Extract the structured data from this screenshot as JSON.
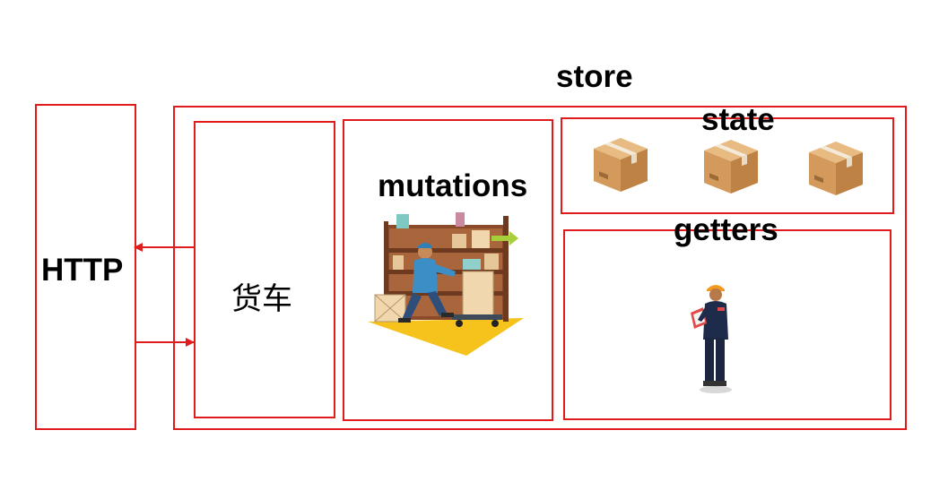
{
  "diagram": {
    "http_label": "HTTP",
    "store_label": "store",
    "cart_label": "货车",
    "mutations_label": "mutations",
    "state_label": "state",
    "getters_label": "getters",
    "colors": {
      "border": "#e01b1b",
      "arrow": "#e01b1b",
      "text": "#000000"
    },
    "icons": {
      "state_items": [
        "box-icon",
        "box-icon",
        "box-icon"
      ],
      "mutations_art": "warehouse-worker-illustration",
      "getters_art": "inspector-worker-illustration"
    }
  }
}
